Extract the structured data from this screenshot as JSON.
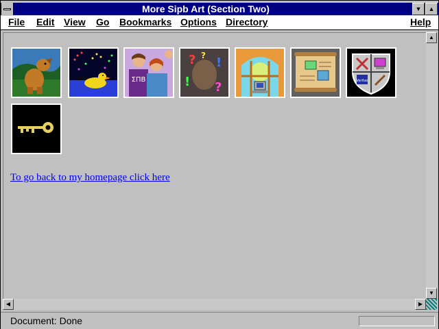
{
  "window": {
    "title": "More Sipb Art (Section Two)"
  },
  "titlebar_buttons": {
    "minimize": "▼",
    "maximize": "▲"
  },
  "menus": [
    {
      "label": "File"
    },
    {
      "label": "Edit"
    },
    {
      "label": "View"
    },
    {
      "label": "Go"
    },
    {
      "label": "Bookmarks"
    },
    {
      "label": "Options"
    },
    {
      "label": "Directory"
    },
    {
      "label": "Help"
    }
  ],
  "gallery": {
    "images": [
      {
        "name": "dog-icon"
      },
      {
        "name": "duck-fireworks-icon"
      },
      {
        "name": "sigma-shirt-people-icon",
        "text": "ΣΠΒ"
      },
      {
        "name": "question-marks-icon",
        "text": "?!"
      },
      {
        "name": "window-computer-icon"
      },
      {
        "name": "blueprint-scroll-icon"
      },
      {
        "name": "shield-crest-icon",
        "text": "Veritas"
      },
      {
        "name": "key-icon"
      }
    ]
  },
  "link": {
    "text": "To go back to my homepage click here "
  },
  "status": {
    "text": "Document: Done",
    "progress": 0
  },
  "colors": {
    "titlebar": "#000080",
    "link": "#0000ee",
    "background": "#c0c0c0"
  }
}
